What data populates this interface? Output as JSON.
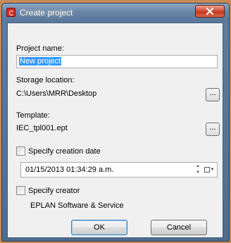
{
  "window": {
    "title": "Create project",
    "app_icon": "eplan-logo-icon",
    "close_icon": "close-icon"
  },
  "project_name": {
    "label": "Project name:",
    "value": "New project"
  },
  "storage_location": {
    "label": "Storage location:",
    "value": "C:\\Users\\MRR\\Desktop",
    "browse_label": "..."
  },
  "template": {
    "label": "Template:",
    "value": "IEC_tpl001.ept",
    "browse_label": "..."
  },
  "creation_date": {
    "checkbox_label": "Specify creation date",
    "checked": false,
    "value": "01/15/2013 01:34:29 a.m."
  },
  "creator": {
    "checkbox_label": "Specify creator",
    "checked": false,
    "value": "EPLAN Software & Service"
  },
  "buttons": {
    "ok": "OK",
    "cancel": "Cancel"
  }
}
